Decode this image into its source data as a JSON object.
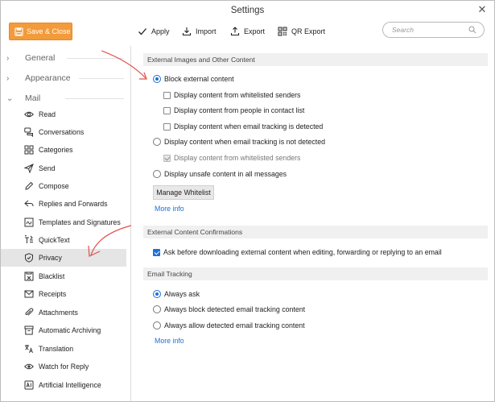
{
  "window": {
    "title": "Settings",
    "close_glyph": "✕"
  },
  "toolbar": {
    "save_label": "Save & Close",
    "apply_label": "Apply",
    "import_label": "Import",
    "export_label": "Export",
    "qr_export_label": "QR Export",
    "search_placeholder": "Search"
  },
  "sidebar": {
    "sections": [
      {
        "label": "General",
        "expanded": false
      },
      {
        "label": "Appearance",
        "expanded": false
      },
      {
        "label": "Mail",
        "expanded": true
      }
    ],
    "items": [
      {
        "label": "Read",
        "icon": "eye-icon"
      },
      {
        "label": "Conversations",
        "icon": "chat-bubbles-icon"
      },
      {
        "label": "Categories",
        "icon": "grid-icon"
      },
      {
        "label": "Send",
        "icon": "paper-plane-icon"
      },
      {
        "label": "Compose",
        "icon": "pencil-icon"
      },
      {
        "label": "Replies and Forwards",
        "icon": "reply-forward-icon"
      },
      {
        "label": "Templates and Signatures",
        "icon": "signature-icon"
      },
      {
        "label": "QuickText",
        "icon": "quicktext-icon"
      },
      {
        "label": "Privacy",
        "icon": "shield-icon",
        "selected": true
      },
      {
        "label": "Blacklist",
        "icon": "blacklist-icon"
      },
      {
        "label": "Receipts",
        "icon": "receipt-icon"
      },
      {
        "label": "Attachments",
        "icon": "paperclip-icon"
      },
      {
        "label": "Automatic Archiving",
        "icon": "archive-icon"
      },
      {
        "label": "Translation",
        "icon": "translate-icon"
      },
      {
        "label": "Watch for Reply",
        "icon": "watch-eye-icon"
      },
      {
        "label": "Artificial Intelligence",
        "icon": "ai-icon"
      }
    ]
  },
  "external_images": {
    "heading": "External Images and Other Content",
    "block_label": "Block external content",
    "block_selected": true,
    "opt_whitelisted": "Display content from whitelisted senders",
    "opt_contacts": "Display content from people in contact list",
    "opt_tracking": "Display content when email tracking is detected",
    "not_detected_label": "Display content when email tracking is not detected",
    "not_detected_sub": "Display content from whitelisted senders",
    "unsafe_label": "Display unsafe content in all messages",
    "manage_button": "Manage Whitelist",
    "more_info": "More info"
  },
  "confirmations": {
    "heading": "External Content Confirmations",
    "ask_label": "Ask before downloading external content when editing, forwarding or replying to an email",
    "ask_checked": true
  },
  "tracking": {
    "heading": "Email Tracking",
    "always_ask": "Always ask",
    "always_block": "Always block detected email tracking content",
    "always_allow": "Always allow detected email tracking content",
    "selected": "always_ask",
    "more_info": "More info"
  },
  "colors": {
    "accent": "#1e6fd9",
    "save_button": "#f39a3a",
    "annotation": "#e0504a"
  }
}
